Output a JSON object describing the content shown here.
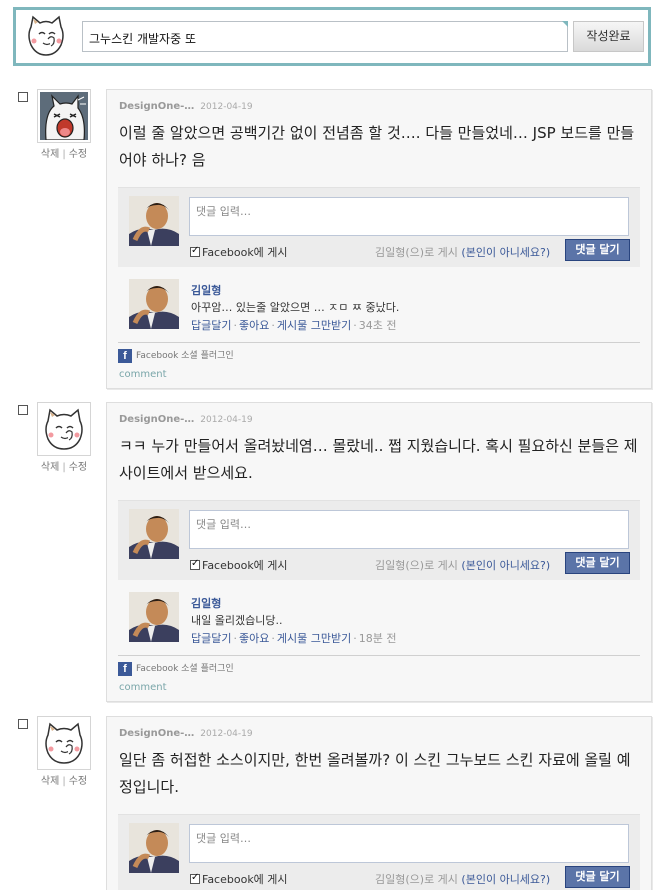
{
  "compose": {
    "value": "그누스킨 개발자중 또",
    "submit_label": "작성완료"
  },
  "posts": [
    {
      "author": "DesignOne-…",
      "date": "2012-04-19",
      "avatar_icon": "screaming-cat-icon",
      "delete_label": "삭제",
      "edit_label": "수정",
      "text": "이럴 줄 알았으면 공백기간 없이 전념좀 할 것…. 다들 만들었네… JSP 보드를 만들어야 하나? 음",
      "comment_placeholder": "댓글 입력…",
      "facebook_post_label": "Facebook에 게시",
      "posting_as": "김일형(으)로 게시",
      "not_you": "(본인이 아니세요?)",
      "comment_button": "댓글 달기",
      "reply": {
        "name": "김일형",
        "text": "아꾸암… 있는줄 알았으면 … ㅈㅁ ㅉ 중났다.",
        "actions": [
          "답글달기",
          "좋아요",
          "게시물 그만받기"
        ],
        "time": "34초 전"
      },
      "plugin_label": "Facebook 소셜 플러그인",
      "comment_link": "comment"
    },
    {
      "author": "DesignOne-…",
      "date": "2012-04-19",
      "avatar_icon": "cat-icon",
      "delete_label": "삭제",
      "edit_label": "수정",
      "text": "ㅋㅋ 누가 만들어서 올려놨네염… 몰랐네.. 쩝 지웠습니다. 혹시 필요하신 분들은 제사이트에서 받으세요.",
      "comment_placeholder": "댓글 입력…",
      "facebook_post_label": "Facebook에 게시",
      "posting_as": "김일형(으)로 게시",
      "not_you": "(본인이 아니세요?)",
      "comment_button": "댓글 달기",
      "reply": {
        "name": "김일형",
        "text": "내일 올리겠습니당..",
        "actions": [
          "답글달기",
          "좋아요",
          "게시물 그만받기"
        ],
        "time": "18분 전"
      },
      "plugin_label": "Facebook 소셜 플러그인",
      "comment_link": "comment"
    },
    {
      "author": "DesignOne-…",
      "date": "2012-04-19",
      "avatar_icon": "cat-icon",
      "delete_label": "삭제",
      "edit_label": "수정",
      "text": "일단 좀 허접한 소스이지만, 한번 올려볼까? 이 스킨 그누보드 스킨 자료에 올릴 예정입니다.",
      "comment_placeholder": "댓글 입력…",
      "facebook_post_label": "Facebook에 게시",
      "posting_as": "김일형(으)로 게시",
      "not_you": "(본인이 아니세요?)",
      "comment_button": "댓글 달기"
    }
  ]
}
